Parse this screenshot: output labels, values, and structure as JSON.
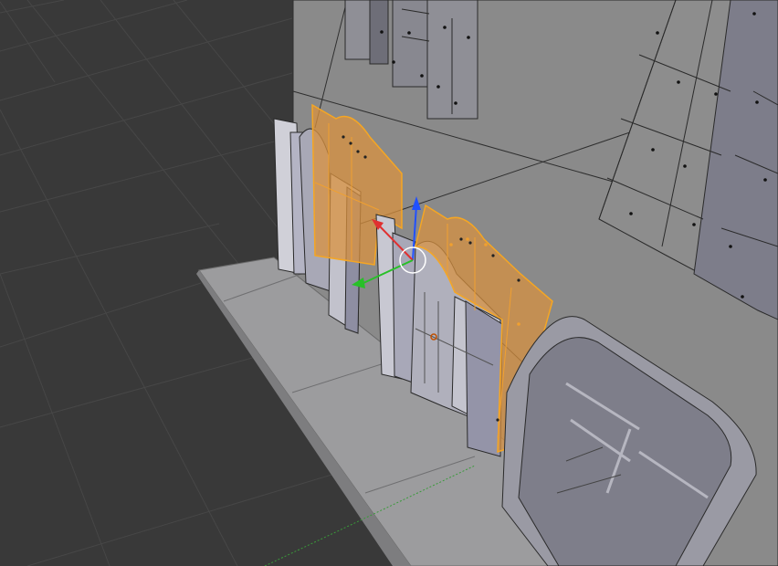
{
  "app": "3D Viewport",
  "scene": {
    "mode": "edit",
    "view": "perspective",
    "selection_color": "#f5a623",
    "selected_fill": "#d9913f",
    "background_color": "#393939",
    "grid_color": "#474747",
    "wall_color": "#8a8a8a",
    "floor_color": "#9c9c9e",
    "axis_colors": {
      "x": "#e03030",
      "y": "#28c028",
      "z": "#2050ff"
    },
    "objects": [
      {
        "name": "wall",
        "selected": false
      },
      {
        "name": "upper-window-left",
        "selected": false
      },
      {
        "name": "upper-window-right",
        "selected": false
      },
      {
        "name": "door-left",
        "selected": false
      },
      {
        "name": "shutter-left",
        "selected": true
      },
      {
        "name": "door-right",
        "selected": false
      },
      {
        "name": "shutter-right",
        "selected": true
      },
      {
        "name": "arched-doorway",
        "selected": false
      },
      {
        "name": "sidewalk-slab",
        "selected": false
      }
    ],
    "manipulator": {
      "type": "translate",
      "axes": [
        "x",
        "y",
        "z"
      ]
    }
  }
}
